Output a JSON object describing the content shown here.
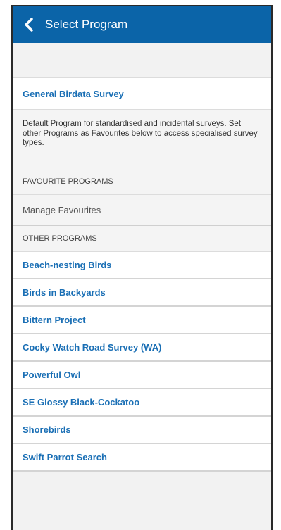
{
  "header": {
    "title": "Select Program"
  },
  "general": {
    "label": "General Birdata Survey",
    "description": "Default Program for standardised and incidental surveys. Set other Programs as Favourites below to access specialised survey types."
  },
  "favourites": {
    "heading": "FAVOURITE PROGRAMS",
    "manage_label": "Manage Favourites"
  },
  "other": {
    "heading": "OTHER PROGRAMS",
    "items": [
      {
        "label": "Beach-nesting Birds"
      },
      {
        "label": "Birds in Backyards"
      },
      {
        "label": "Bittern Project"
      },
      {
        "label": "Cocky Watch Road Survey (WA)"
      },
      {
        "label": "Powerful Owl"
      },
      {
        "label": "SE Glossy Black-Cockatoo"
      },
      {
        "label": "Shorebirds"
      },
      {
        "label": "Swift Parrot Search"
      }
    ]
  },
  "colors": {
    "header_bg": "#0b64a8",
    "link": "#1a6fb5"
  }
}
